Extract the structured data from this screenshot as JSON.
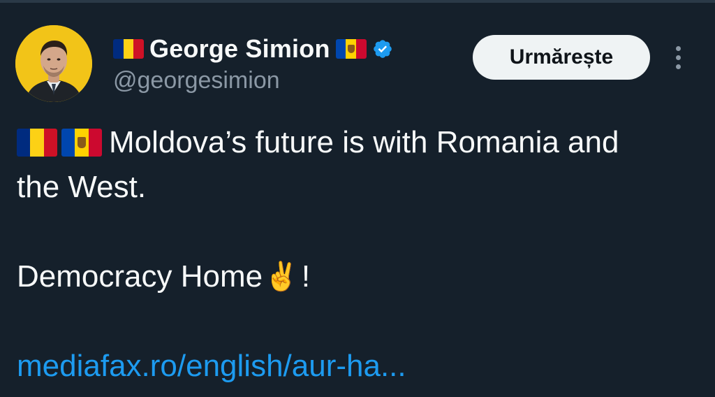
{
  "colors": {
    "background": "#15202b",
    "text": "#f7f9f9",
    "secondary_text": "#8b98a5",
    "link": "#1d9bf0",
    "verified": "#1d9bf0",
    "follow_bg": "#eff3f4"
  },
  "author": {
    "display_name": "George Simion",
    "handle": "@georgesimion",
    "verified": true,
    "avatar_icon": "avatar"
  },
  "header": {
    "follow_label": "Urmărește",
    "more_icon": "more-vertical-icon"
  },
  "tweet": {
    "line1": "Moldova’s future is with Romania and",
    "line2": "the West.",
    "line3_text": "Democracy Home",
    "line3_emoji": "✌️",
    "line3_end": "!",
    "link_text": "mediafax.ro/english/aur-ha..."
  },
  "flags": {
    "romania": [
      "#002b7f",
      "#fcd116",
      "#ce1126"
    ],
    "moldova": [
      "#0046ae",
      "#ffd200",
      "#cc092f"
    ]
  }
}
